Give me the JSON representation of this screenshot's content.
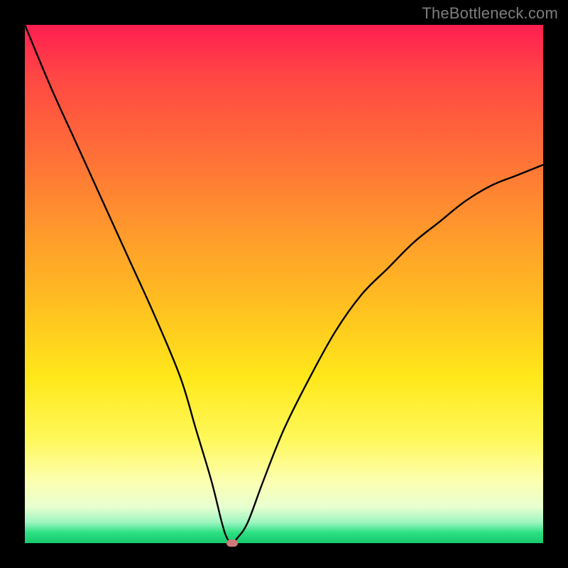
{
  "brand": "TheBottleneck.com",
  "chart_data": {
    "type": "line",
    "title": "",
    "xlabel": "",
    "ylabel": "",
    "xlim": [
      0,
      100
    ],
    "ylim": [
      0,
      100
    ],
    "grid": false,
    "series": [
      {
        "name": "curve",
        "x": [
          0,
          5,
          10,
          15,
          20,
          25,
          30,
          33,
          36,
          38,
          39,
          40,
          41,
          43,
          46,
          50,
          55,
          60,
          65,
          70,
          75,
          80,
          85,
          90,
          95,
          100
        ],
        "values": [
          100,
          88,
          77,
          66,
          55,
          44,
          32,
          22,
          12,
          4,
          1,
          0,
          1,
          4,
          12,
          22,
          32,
          41,
          48,
          53,
          58,
          62,
          66,
          69,
          71,
          73
        ]
      }
    ],
    "marker": {
      "x": 40,
      "y": 0,
      "color": "#cf7b7b"
    }
  }
}
